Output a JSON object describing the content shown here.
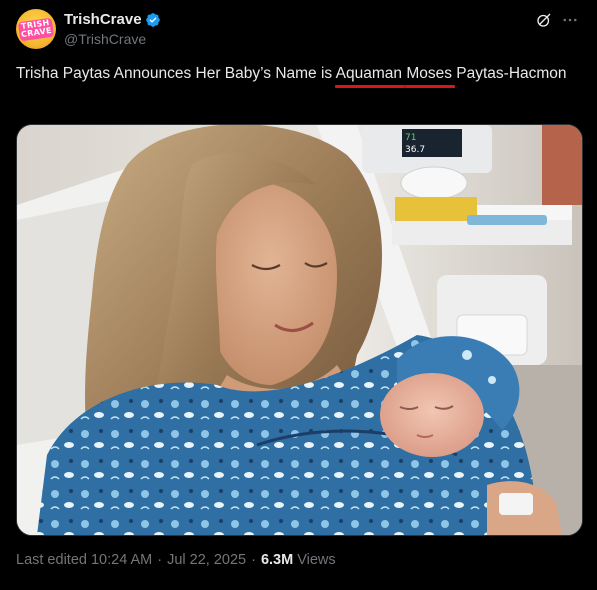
{
  "author": {
    "display_name": "TrishCrave",
    "handle": "@TrishCrave",
    "avatar_text": "TRISH CRAVE",
    "verified": true
  },
  "tweet": {
    "text_parts": [
      "Trisha Paytas Announces Her Baby’s Name is ",
      "Aquaman",
      " ",
      "Moses",
      " Paytas-Hacmon"
    ],
    "highlight_color": "#d81818"
  },
  "media": {
    "monitor_readouts": [
      "71",
      "36.7"
    ]
  },
  "footer": {
    "last_edited": "Last edited 10:24 AM",
    "date": "Jul 22, 2025",
    "views_count": "6.3M",
    "views_label": "Views",
    "separator": "·"
  },
  "colors": {
    "background": "#000000",
    "text": "#e7e9ea",
    "muted": "#71767b",
    "verified_blue": "#1d9bf0"
  },
  "icons": [
    "verified-badge-icon",
    "grok-icon",
    "more-icon"
  ]
}
